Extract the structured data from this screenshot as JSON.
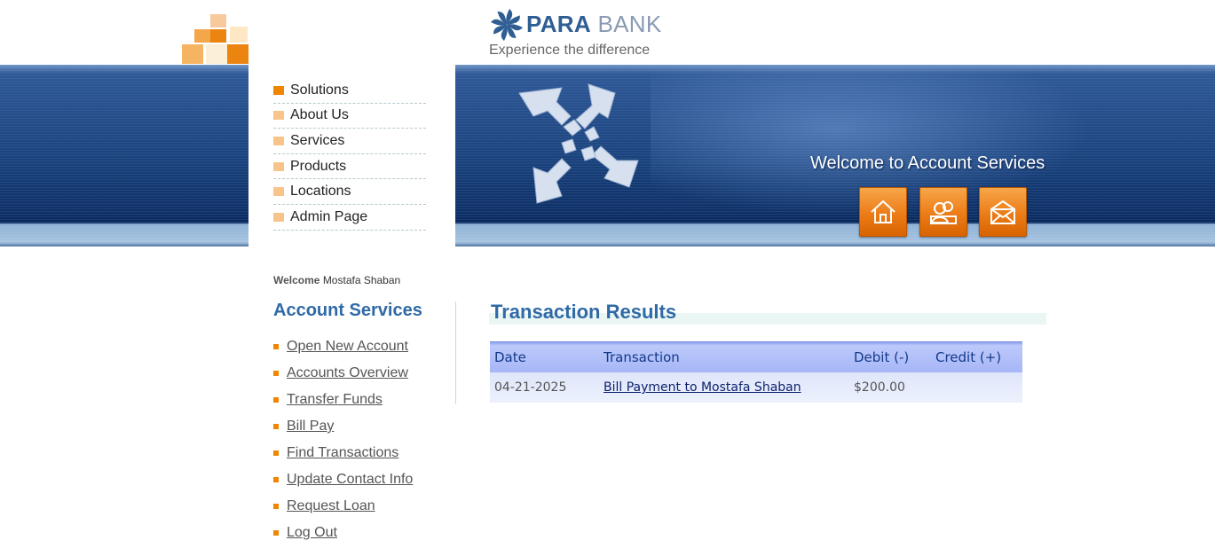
{
  "brand": {
    "name_part1": "PARA",
    "name_part2": "BANK",
    "tagline": "Experience the difference",
    "accent_color": "#f08600",
    "primary_color": "#2f6aa6"
  },
  "banner": {
    "welcome": "Welcome to Account Services",
    "icons": [
      "home-icon",
      "contact-icon",
      "mail-icon"
    ]
  },
  "top_menu": {
    "items": [
      "Solutions",
      "About Us",
      "Services",
      "Products",
      "Locations",
      "Admin Page"
    ]
  },
  "user": {
    "welcome_label": "Welcome",
    "name": "Mostafa Shaban"
  },
  "account_services": {
    "title": "Account Services",
    "links": [
      "Open New Account",
      "Accounts Overview",
      "Transfer Funds",
      "Bill Pay",
      "Find Transactions",
      "Update Contact Info",
      "Request Loan",
      "Log Out"
    ]
  },
  "results": {
    "title": "Transaction Results",
    "columns": [
      "Date",
      "Transaction",
      "Debit (-)",
      "Credit (+)"
    ],
    "rows": [
      {
        "date": "04-21-2025",
        "transaction": "Bill Payment to Mostafa Shaban",
        "debit": "$200.00",
        "credit": ""
      }
    ]
  }
}
